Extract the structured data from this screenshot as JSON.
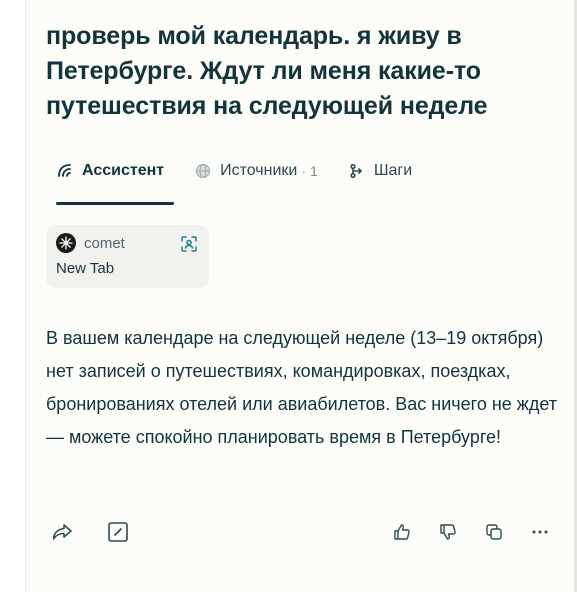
{
  "query": {
    "text": "проверь мой календарь. я живу в Петербурге. Ждут ли меня какие-то путешествия на следующей неделе"
  },
  "tabs": [
    {
      "label": "Ассистент",
      "icon": "perplexity-arc-icon",
      "active": true
    },
    {
      "label": "Источники",
      "icon": "globe-icon",
      "separator": "·",
      "count": "1"
    },
    {
      "label": "Шаги",
      "icon": "steps-icon"
    }
  ],
  "source_card": {
    "site": "comet",
    "title": "New Tab",
    "logo_icon": "comet-logo-icon",
    "action_icon": "scan-icon"
  },
  "answer": {
    "text": "В вашем календаре на следующей неделе (13–19 октября) нет записей о путешествиях, командировках, поездках, бронированиях отелей или авиабилетов. Вас ничего не ждет — можете спокойно планировать время в Петербурге!"
  },
  "actions": {
    "left": [
      "share-icon",
      "edit-icon"
    ],
    "right": [
      "thumbs-up-icon",
      "thumbs-down-icon",
      "copy-icon",
      "more-icon"
    ]
  },
  "colors": {
    "text": "#13343b",
    "background": "#fcfcf9",
    "card": "#f1f1ed",
    "accent": "#20808d"
  }
}
